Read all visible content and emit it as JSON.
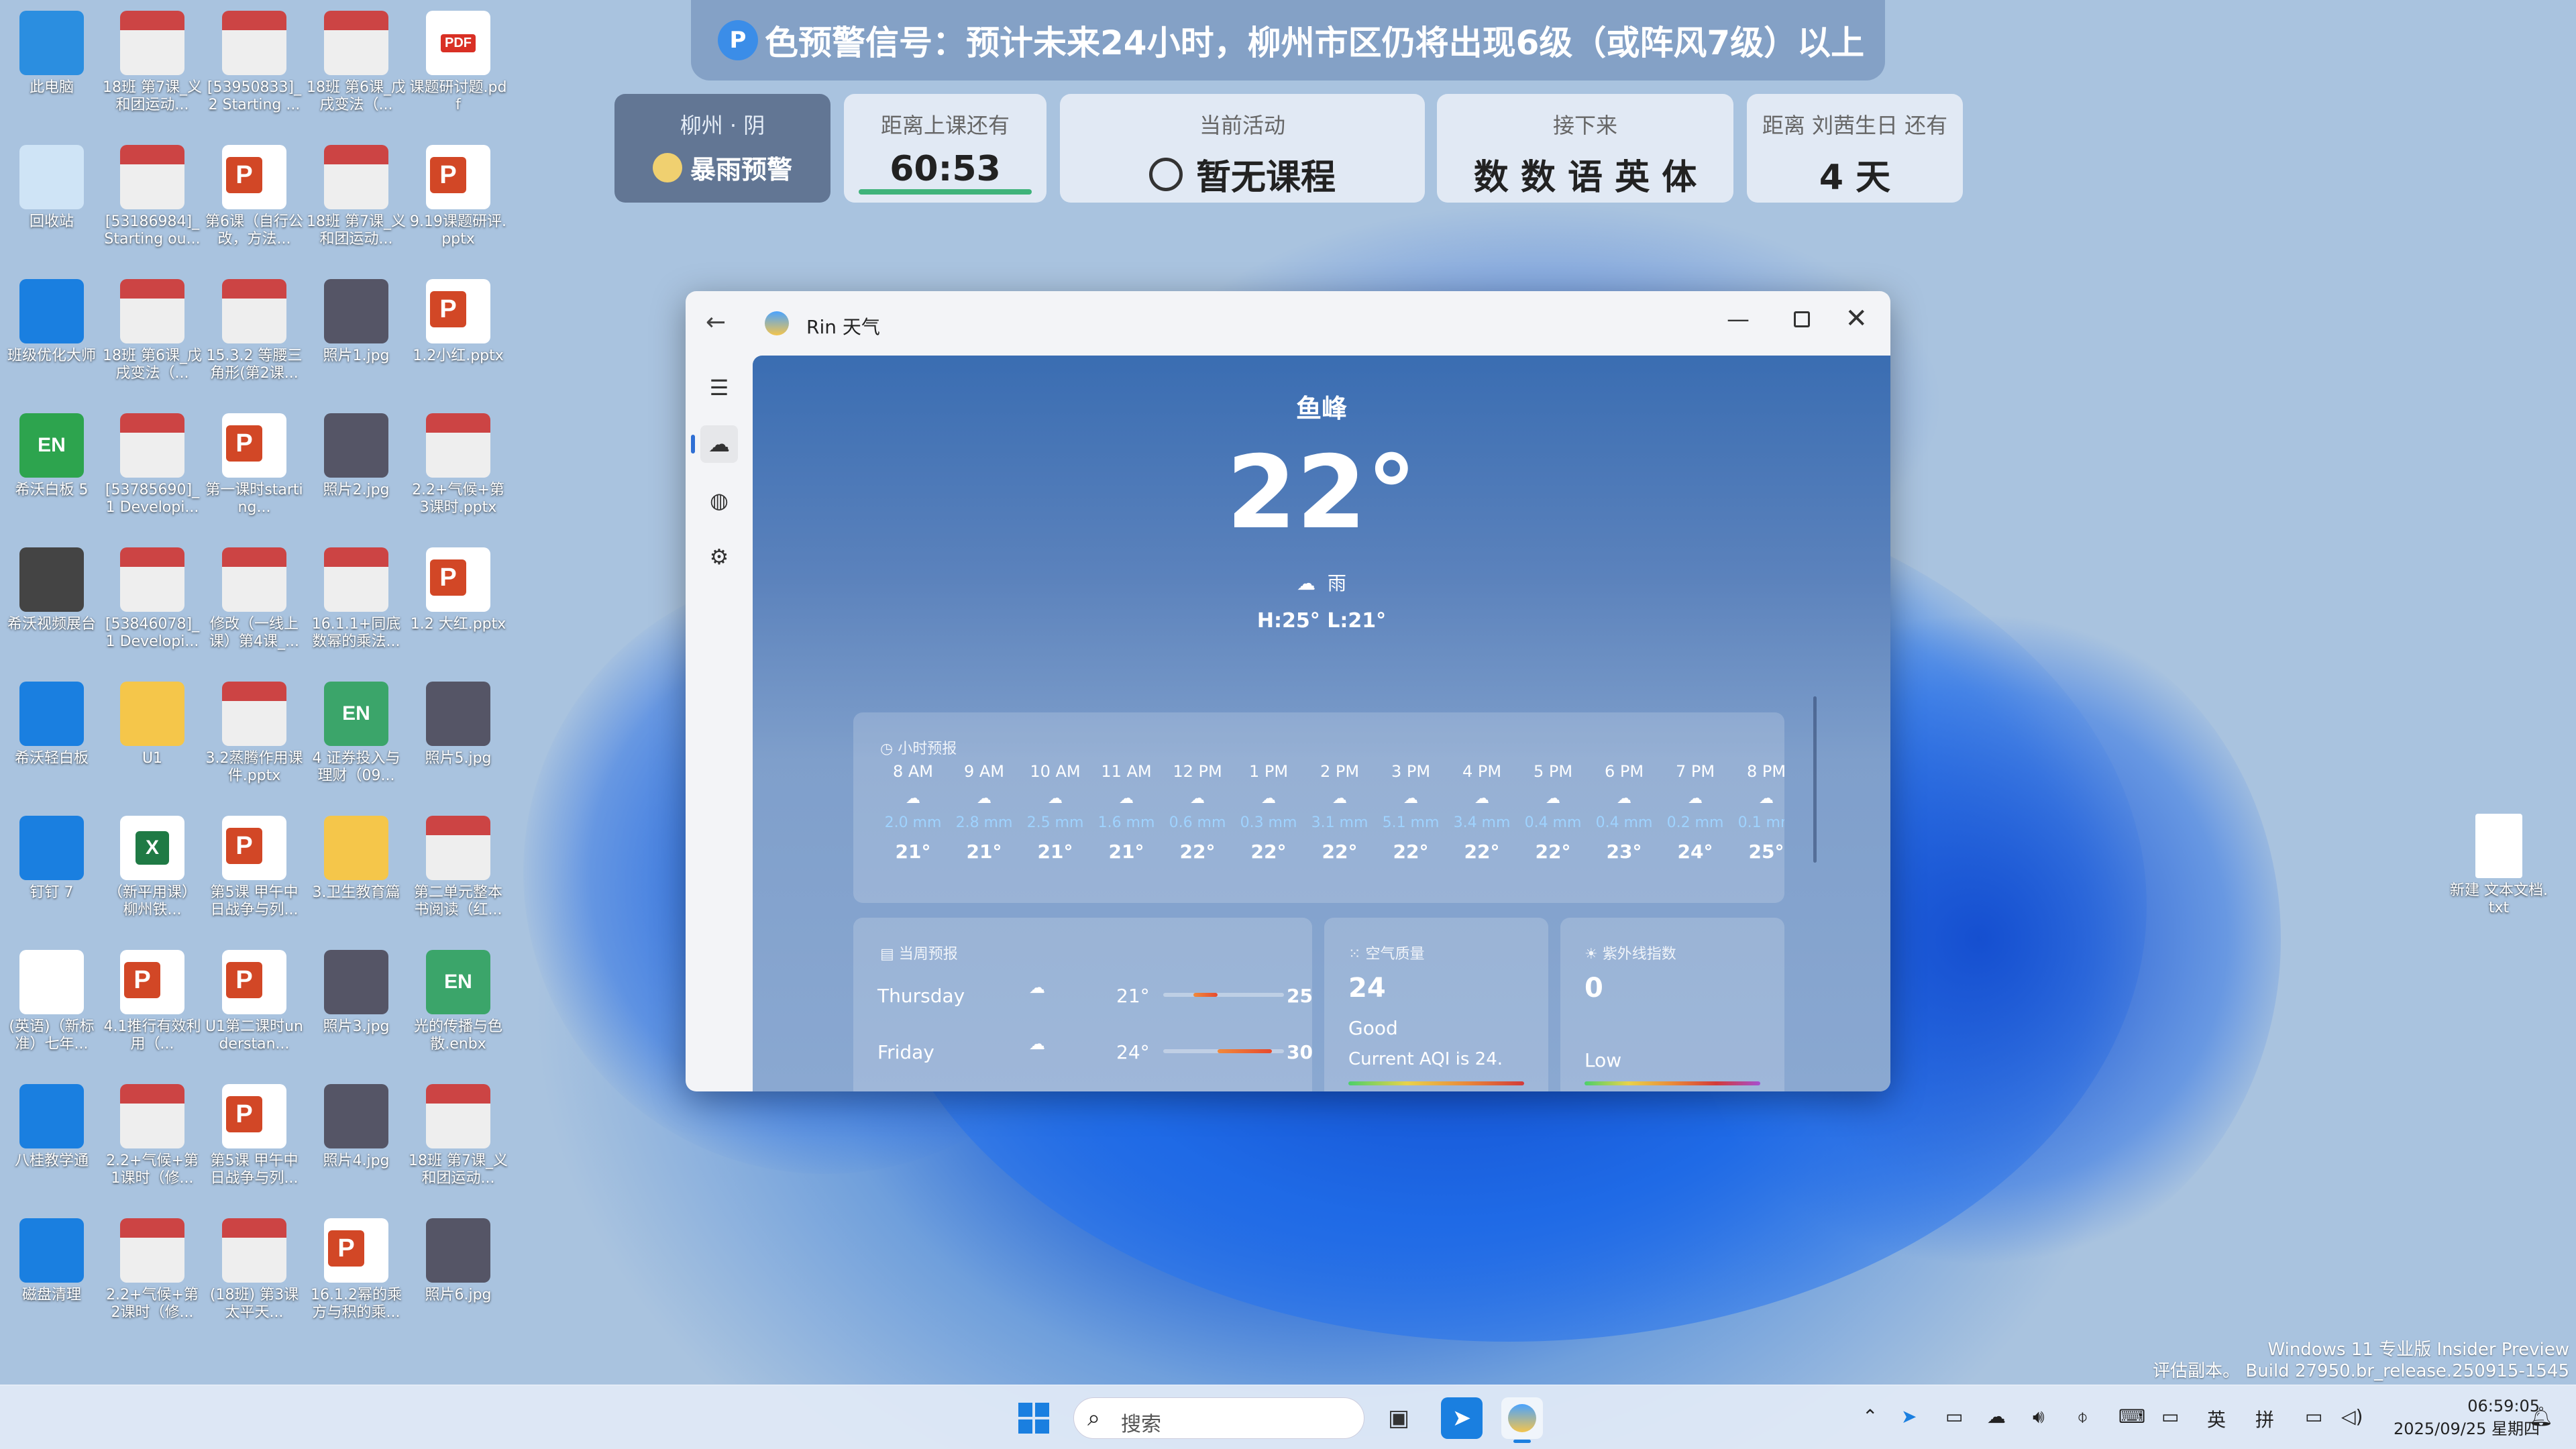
{
  "desktop_icons": [
    {
      "label": "此电脑"
    },
    {
      "label": "18班 第7课_义和团运动..."
    },
    {
      "label": "[53950833]_2 Starting ..."
    },
    {
      "label": "18班 第6课_戊戌变法（..."
    },
    {
      "label": "课题研讨题.pdf"
    },
    {
      "label": "回收站"
    },
    {
      "label": "[53186984]_Starting ou..."
    },
    {
      "label": "第6课（自行公改，方法..."
    },
    {
      "label": "18班 第7课_义和团运动..."
    },
    {
      "label": "9.19课题研评.pptx"
    },
    {
      "label": "班级优化大师"
    },
    {
      "label": "18班 第6课_戊戌变法（..."
    },
    {
      "label": "15.3.2 等腰三角形(第2课..."
    },
    {
      "label": "照片1.jpg"
    },
    {
      "label": "1.2小红.pptx"
    },
    {
      "label": "希沃白板 5"
    },
    {
      "label": "[53785690]_1 Developi..."
    },
    {
      "label": "第一课时starting..."
    },
    {
      "label": "照片2.jpg"
    },
    {
      "label": "2.2+气候+第3课时.pptx"
    },
    {
      "label": "希沃视频展台"
    },
    {
      "label": "[53846078]_1 Developi..."
    },
    {
      "label": "修改（一线上课）第4课_..."
    },
    {
      "label": "16.1.1+同底数幂的乘法..."
    },
    {
      "label": "1.2 大红.pptx"
    },
    {
      "label": "希沃轻白板"
    },
    {
      "label": "U1"
    },
    {
      "label": "3.2蒸腾作用课件.pptx"
    },
    {
      "label": "4 证券投入与理财（09..."
    },
    {
      "label": "照片5.jpg"
    },
    {
      "label": "钉钉 7"
    },
    {
      "label": "（新平用课）柳州铁..."
    },
    {
      "label": "第5课 甲午中日战争与列..."
    },
    {
      "label": "3.卫生教育篇"
    },
    {
      "label": "第二单元整本书阅读（红..."
    },
    {
      "label": "(英语)（新标准）七年..."
    },
    {
      "label": "4.1推行有效利用（..."
    },
    {
      "label": "U1第二课时understan..."
    },
    {
      "label": "照片3.jpg"
    },
    {
      "label": "光的传播与色散.enbx"
    },
    {
      "label": "八桂教学通"
    },
    {
      "label": "2.2+气候+第1课时（修..."
    },
    {
      "label": "第5课 甲午中日战争与列..."
    },
    {
      "label": "照片4.jpg"
    },
    {
      "label": "18班 第7课_义和团运动..."
    },
    {
      "label": "磁盘清理"
    },
    {
      "label": "2.2+气候+第2课时（修..."
    },
    {
      "label": "(18班) 第3课 太平天..."
    },
    {
      "label": "16.1.2幂的乘方与积的乘..."
    },
    {
      "label": "照片6.jpg"
    }
  ],
  "desktop_right_icon": {
    "label": "新建 文本文档.txt"
  },
  "banner": {
    "text": "色预警信号：预计未来24小时，柳州市区仍将出现6级（或阵风7级）以上"
  },
  "cards": {
    "weather": {
      "top": "柳州 · 阴",
      "bottom": "暴雨预警"
    },
    "class": {
      "title": "距离上课还有",
      "value": "60:53"
    },
    "activity": {
      "title": "当前活动",
      "value": "暂无课程"
    },
    "next": {
      "title": "接下来",
      "value": "数 数 语 英 体"
    },
    "birthday": {
      "title": "距离 刘茜生日 还有",
      "value": "4 天"
    }
  },
  "window": {
    "title": "Rin 天气",
    "city": "鱼峰",
    "temp": "22°",
    "condition": "雨",
    "hilo": "H:25° L:21°",
    "hourly_title": "小时预报",
    "hourly": [
      {
        "time": "8 AM",
        "mm": "2.0 mm",
        "temp": "21°"
      },
      {
        "time": "9 AM",
        "mm": "2.8 mm",
        "temp": "21°"
      },
      {
        "time": "10 AM",
        "mm": "2.5 mm",
        "temp": "21°"
      },
      {
        "time": "11 AM",
        "mm": "1.6 mm",
        "temp": "21°"
      },
      {
        "time": "12 PM",
        "mm": "0.6 mm",
        "temp": "22°"
      },
      {
        "time": "1 PM",
        "mm": "0.3 mm",
        "temp": "22°"
      },
      {
        "time": "2 PM",
        "mm": "3.1 mm",
        "temp": "22°"
      },
      {
        "time": "3 PM",
        "mm": "5.1 mm",
        "temp": "22°"
      },
      {
        "time": "4 PM",
        "mm": "3.4 mm",
        "temp": "22°"
      },
      {
        "time": "5 PM",
        "mm": "0.4 mm",
        "temp": "22°"
      },
      {
        "time": "6 PM",
        "mm": "0.4 mm",
        "temp": "23°"
      },
      {
        "time": "7 PM",
        "mm": "0.2 mm",
        "temp": "24°"
      },
      {
        "time": "8 PM",
        "mm": "0.1 mm",
        "temp": "25°"
      }
    ],
    "daily_title": "当周预报",
    "daily": [
      {
        "day": "Thursday",
        "low": "21°",
        "high": "25°",
        "bar_from": 0.25,
        "bar_to": 0.45
      },
      {
        "day": "Friday",
        "low": "24°",
        "high": "30°",
        "bar_from": 0.45,
        "bar_to": 0.9
      }
    ],
    "aqi_title": "空气质量",
    "aqi_value": "24",
    "aqi_label": "Good",
    "aqi_desc": "Current AQI is 24.",
    "uv_title": "紫外线指数",
    "uv_value": "0",
    "uv_label": "Low"
  },
  "watermark": {
    "line1": "Windows 11 专业版 Insider Preview",
    "line2": "评估副本。 Build 27950.br_release.250915-1545"
  },
  "taskbar": {
    "search_placeholder": "搜索",
    "ime1": "英",
    "ime2": "拼",
    "time": "06:59:05",
    "date": "2025/09/25 星期四"
  }
}
